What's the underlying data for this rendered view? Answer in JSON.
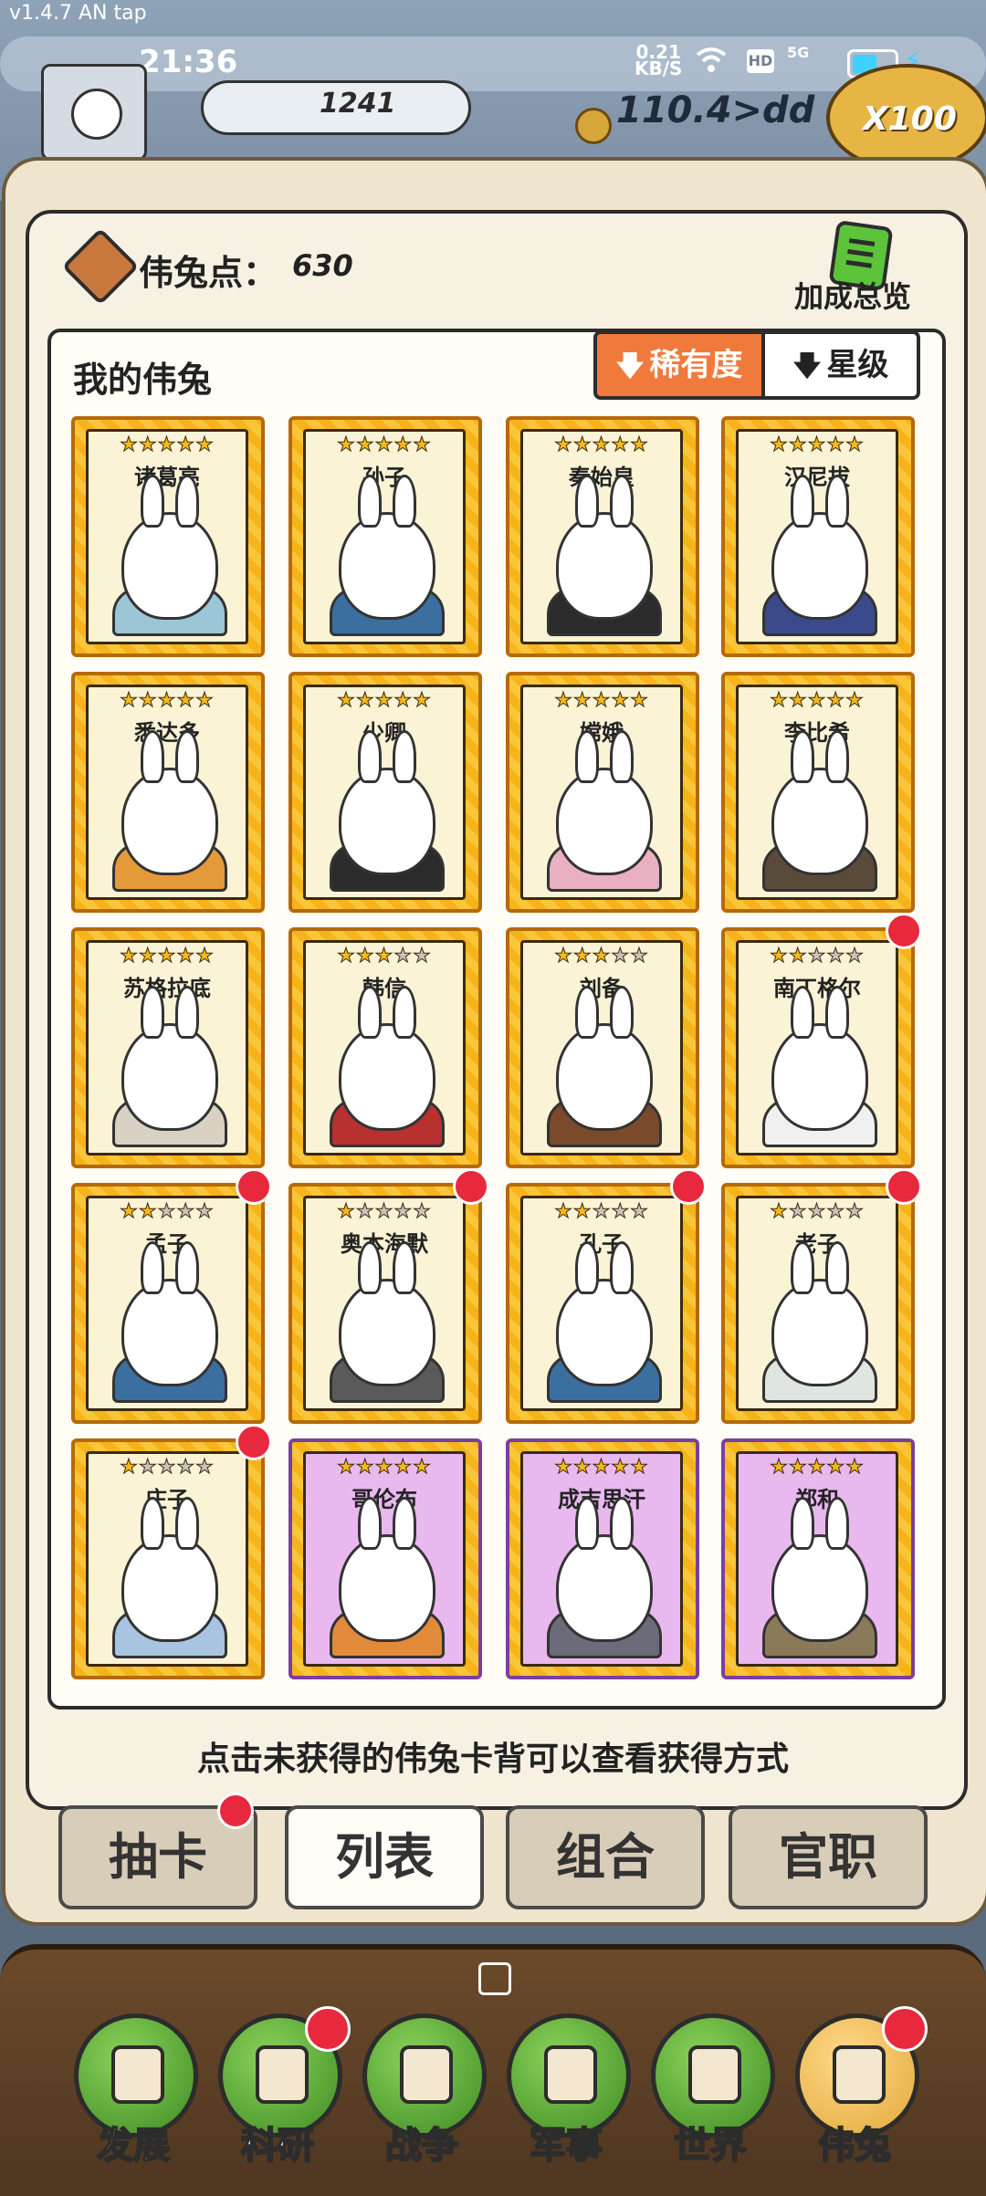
{
  "app": {
    "version": "v1.4.7 AN tap"
  },
  "status_bar": {
    "time": "21:36",
    "speed": "0.21",
    "speed_unit": "KB/S",
    "hd": "HD",
    "signal": "5G"
  },
  "hud": {
    "resource_value": "1241",
    "coins_value": "110.4>dd",
    "multiplier": "X100"
  },
  "panel": {
    "points_label": "伟兔点：",
    "points_value": "630",
    "bonus_label": "加成总览",
    "list_title": "我的伟兔",
    "sort_rarity": "稀有度",
    "sort_star": "星级",
    "hint": "点击未获得的伟兔卡背可以查看获得方式"
  },
  "cards": [
    {
      "name": "诸葛亮",
      "stars": 5,
      "rarity": "gold",
      "new": false
    },
    {
      "name": "孙子",
      "stars": 5,
      "rarity": "gold",
      "new": false
    },
    {
      "name": "秦始皇",
      "stars": 5,
      "rarity": "gold",
      "new": false
    },
    {
      "name": "汉尼拔",
      "stars": 5,
      "rarity": "gold",
      "new": false
    },
    {
      "name": "悉达多",
      "stars": 5,
      "rarity": "gold",
      "new": false
    },
    {
      "name": "少卿",
      "stars": 5,
      "rarity": "gold",
      "new": false
    },
    {
      "name": "嫦娥",
      "stars": 5,
      "rarity": "gold",
      "new": false
    },
    {
      "name": "李比希",
      "stars": 5,
      "rarity": "gold",
      "new": false
    },
    {
      "name": "苏格拉底",
      "stars": 5,
      "rarity": "gold",
      "new": false
    },
    {
      "name": "韩信",
      "stars": 3,
      "rarity": "gold",
      "new": false
    },
    {
      "name": "刘备",
      "stars": 3,
      "rarity": "gold",
      "new": false
    },
    {
      "name": "南丁格尔",
      "stars": 2,
      "rarity": "gold",
      "new": true
    },
    {
      "name": "孟子",
      "stars": 2,
      "rarity": "gold",
      "new": true
    },
    {
      "name": "奥本海默",
      "stars": 1,
      "rarity": "gold",
      "new": true
    },
    {
      "name": "孔子",
      "stars": 2,
      "rarity": "gold",
      "new": true
    },
    {
      "name": "老子",
      "stars": 1,
      "rarity": "gold",
      "new": true
    },
    {
      "name": "庄子",
      "stars": 1,
      "rarity": "gold",
      "new": true
    },
    {
      "name": "哥伦布",
      "stars": 5,
      "rarity": "purple",
      "new": false
    },
    {
      "name": "成吉思汗",
      "stars": 5,
      "rarity": "purple",
      "new": false
    },
    {
      "name": "郑和",
      "stars": 5,
      "rarity": "purple",
      "new": false
    }
  ],
  "tabs": [
    {
      "label": "抽卡",
      "active": false,
      "badge": true
    },
    {
      "label": "列表",
      "active": true,
      "badge": false
    },
    {
      "label": "组合",
      "active": false,
      "badge": false
    },
    {
      "label": "官职",
      "active": false,
      "badge": false
    }
  ],
  "nav": [
    {
      "label": "发展",
      "icon": "axe-icon",
      "active": false,
      "badge": false
    },
    {
      "label": "科研",
      "icon": "flask-icon",
      "active": false,
      "badge": true
    },
    {
      "label": "战争",
      "icon": "swords-icon",
      "active": false,
      "badge": false
    },
    {
      "label": "军事",
      "icon": "helmet-icon",
      "active": false,
      "badge": false
    },
    {
      "label": "世界",
      "icon": "globe-icon",
      "active": false,
      "badge": false
    },
    {
      "label": "伟兔",
      "icon": "card-icon",
      "active": true,
      "badge": true
    }
  ],
  "colors": {
    "badge": "#e8283c",
    "sort_active": "#f07a3c",
    "card_gold": "#f6b31a",
    "card_purple": "#e9b8ef"
  }
}
